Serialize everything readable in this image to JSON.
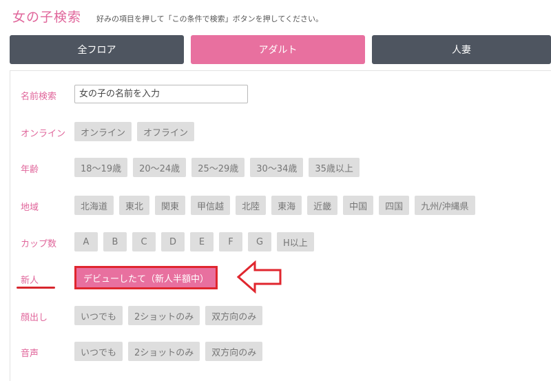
{
  "header": {
    "title": "女の子検索",
    "subtitle": "好みの項目を押して「この条件で検索」ボタンを押してください。"
  },
  "tabs": [
    {
      "label": "全フロア",
      "active": false
    },
    {
      "label": "アダルト",
      "active": true
    },
    {
      "label": "人妻",
      "active": false
    }
  ],
  "colors": {
    "accent": "#e8709f",
    "tab_dark": "#4e5560",
    "highlight": "#e0262e"
  },
  "filters": {
    "name": {
      "label": "名前検索",
      "placeholder": "女の子の名前を入力"
    },
    "online": {
      "label": "オンライン",
      "options": [
        "オンライン",
        "オフライン"
      ]
    },
    "age": {
      "label": "年齢",
      "options": [
        "18〜19歳",
        "20〜24歳",
        "25〜29歳",
        "30〜34歳",
        "35歳以上"
      ]
    },
    "region": {
      "label": "地域",
      "options": [
        "北海道",
        "東北",
        "関東",
        "甲信越",
        "北陸",
        "東海",
        "近畿",
        "中国",
        "四国",
        "九州/沖縄県"
      ]
    },
    "cup": {
      "label": "カップ数",
      "options": [
        "A",
        "B",
        "C",
        "D",
        "E",
        "F",
        "G",
        "H以上"
      ]
    },
    "newcomer": {
      "label": "新人",
      "option": "デビューしたて（新人半額中）",
      "selected": true
    },
    "face": {
      "label": "顔出し",
      "options": [
        "いつでも",
        "2ショットのみ",
        "双方向のみ"
      ]
    },
    "voice": {
      "label": "音声",
      "options": [
        "いつでも",
        "2ショットのみ",
        "双方向のみ"
      ]
    }
  },
  "annotation": {
    "arrow_icon": "left-arrow-outline-icon"
  }
}
